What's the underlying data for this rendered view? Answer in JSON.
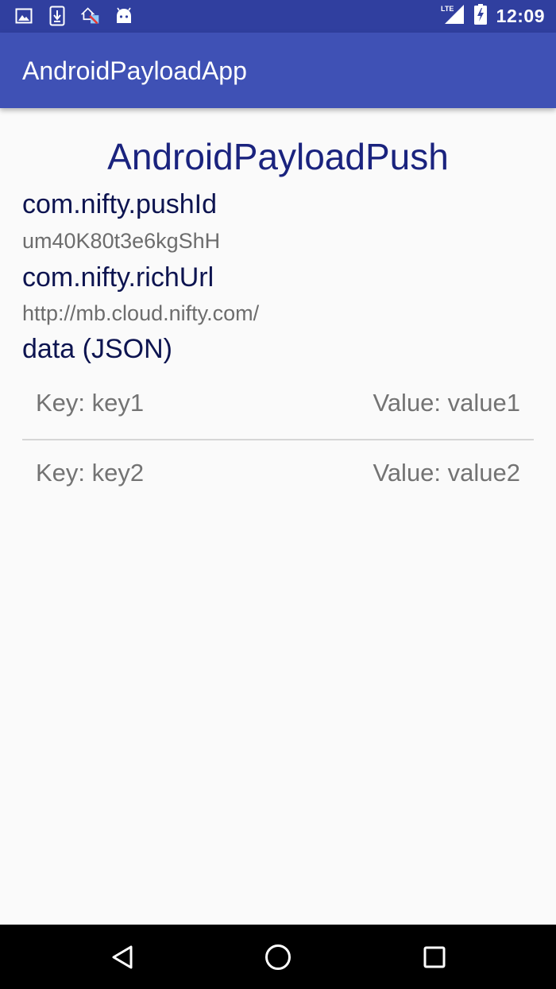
{
  "status_bar": {
    "time": "12:09",
    "network_label": "LTE",
    "left_icons": [
      "image-icon",
      "download-icon",
      "network-warning-icon",
      "android-icon"
    ],
    "right_icons": [
      "signal-icon",
      "battery-charging-icon"
    ]
  },
  "app_bar": {
    "title": "AndroidPayloadApp",
    "color": "#3f51b5"
  },
  "main": {
    "title": "AndroidPayloadPush",
    "push_id": {
      "label": "com.nifty.pushId",
      "value": "um40K80t3e6kgShH"
    },
    "rich_url": {
      "label": "com.nifty.richUrl",
      "value": "http://mb.cloud.nifty.com/"
    },
    "data_label": "data (JSON)",
    "data_rows": [
      {
        "key": "Key: key1",
        "value": "Value: value1"
      },
      {
        "key": "Key: key2",
        "value": "Value: value2"
      }
    ]
  },
  "nav_bar": {
    "buttons": [
      "back-icon",
      "home-icon",
      "recents-icon"
    ]
  }
}
